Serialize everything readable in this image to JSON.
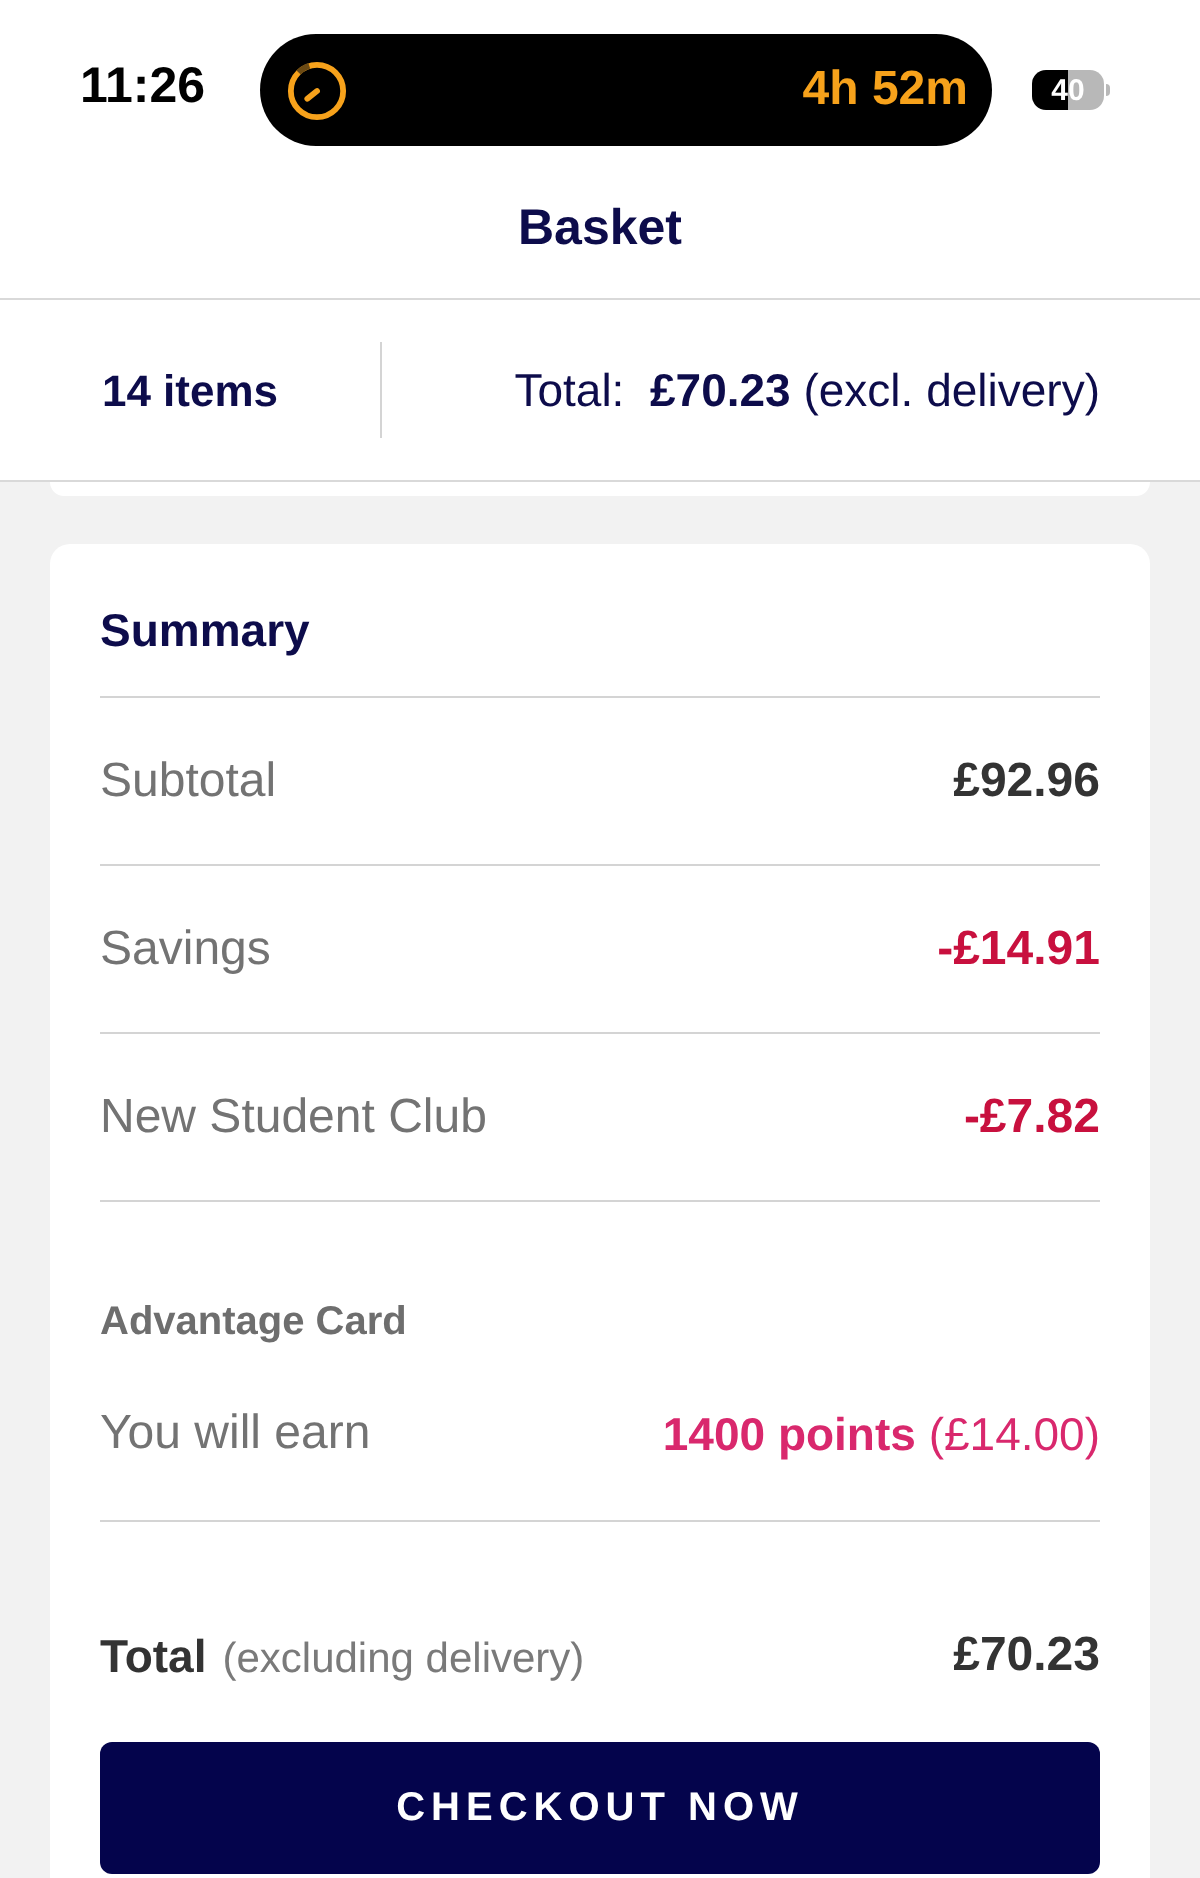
{
  "status_bar": {
    "time": "11:26",
    "activity": {
      "timer": "4h 52m"
    },
    "battery": "40"
  },
  "header": {
    "title": "Basket"
  },
  "basket_bar": {
    "items": "14 items",
    "total": "Total:  **£70.23** (excl. delivery)"
  },
  "summary": {
    "title": "Summary",
    "rows": [
      {
        "label": "Subtotal",
        "value": "£92.96",
        "kind": "plain"
      },
      {
        "label": "Savings",
        "value": "-£14.91",
        "kind": "discount"
      },
      {
        "label": "New Student Club",
        "value": "-£7.82",
        "kind": "discount"
      }
    ],
    "advantage_card": {
      "title": "Advantage Card",
      "label": "You will earn",
      "points": "**1400 points** (£14.00)"
    },
    "total": {
      "label": "Total",
      "note": "(excluding delivery)",
      "value": "£70.23"
    },
    "checkout_button": "CHECKOUT NOW"
  }
}
